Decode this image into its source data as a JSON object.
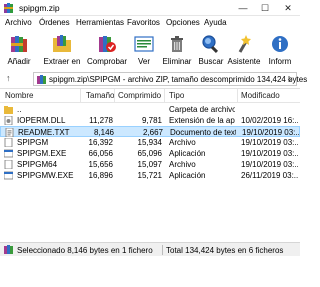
{
  "window": {
    "title": "spipgm.zip"
  },
  "menu": [
    "Archivo",
    "Órdenes",
    "Herramientas",
    "Favoritos",
    "Opciones",
    "Ayuda"
  ],
  "toolbar": [
    {
      "label": "Añadir",
      "icon": "books-add-icon"
    },
    {
      "label": "Extraer en",
      "icon": "folder-extract-icon"
    },
    {
      "label": "Comprobar",
      "icon": "test-archive-icon"
    },
    {
      "label": "Ver",
      "icon": "view-icon"
    },
    {
      "label": "Eliminar",
      "icon": "trash-icon"
    },
    {
      "label": "Buscar",
      "icon": "magnifier-icon"
    },
    {
      "label": "Asistente",
      "icon": "wizard-icon"
    },
    {
      "label": "Inform",
      "icon": "info-icon"
    }
  ],
  "address": {
    "path": "spipgm.zip\\SPIPGM - archivo ZIP, tamaño descomprimido 134,424 bytes"
  },
  "columns": {
    "name": "Nombre",
    "size": "Tamaño",
    "compressed": "Comprimido",
    "type": "Tipo",
    "modified": "Modificado"
  },
  "files": [
    {
      "name": "..",
      "size": "",
      "compressed": "",
      "type": "Carpeta de archivos",
      "modified": "",
      "icon": "folder-up-icon",
      "selected": false
    },
    {
      "name": "IOPERM.DLL",
      "size": "11,278",
      "compressed": "9,781",
      "type": "Extensión de la apl...",
      "modified": "10/02/2019 16:...",
      "icon": "dll-file-icon",
      "selected": false
    },
    {
      "name": "README.TXT",
      "size": "8,146",
      "compressed": "2,667",
      "type": "Documento de texto",
      "modified": "19/10/2019 03:...",
      "icon": "text-file-icon",
      "selected": true
    },
    {
      "name": "SPIPGM",
      "size": "16,392",
      "compressed": "15,934",
      "type": "Archivo",
      "modified": "19/10/2019 03:...",
      "icon": "file-icon",
      "selected": false
    },
    {
      "name": "SPIPGM.EXE",
      "size": "66,056",
      "compressed": "65,096",
      "type": "Aplicación",
      "modified": "19/10/2019 03:...",
      "icon": "exe-file-icon",
      "selected": false
    },
    {
      "name": "SPIPGM64",
      "size": "15,656",
      "compressed": "15,097",
      "type": "Archivo",
      "modified": "19/10/2019 03:...",
      "icon": "file-icon",
      "selected": false
    },
    {
      "name": "SPIPGMW.EXE",
      "size": "16,896",
      "compressed": "15,721",
      "type": "Aplicación",
      "modified": "26/11/2019 03:...",
      "icon": "exe-file-icon",
      "selected": false
    }
  ],
  "status": {
    "left": "Seleccionado 8,146 bytes en 1 fichero",
    "right": "Total 134,424 bytes en 6 ficheros"
  },
  "colors": {
    "selection": "#cce8ff",
    "accent": "#0078d7"
  }
}
